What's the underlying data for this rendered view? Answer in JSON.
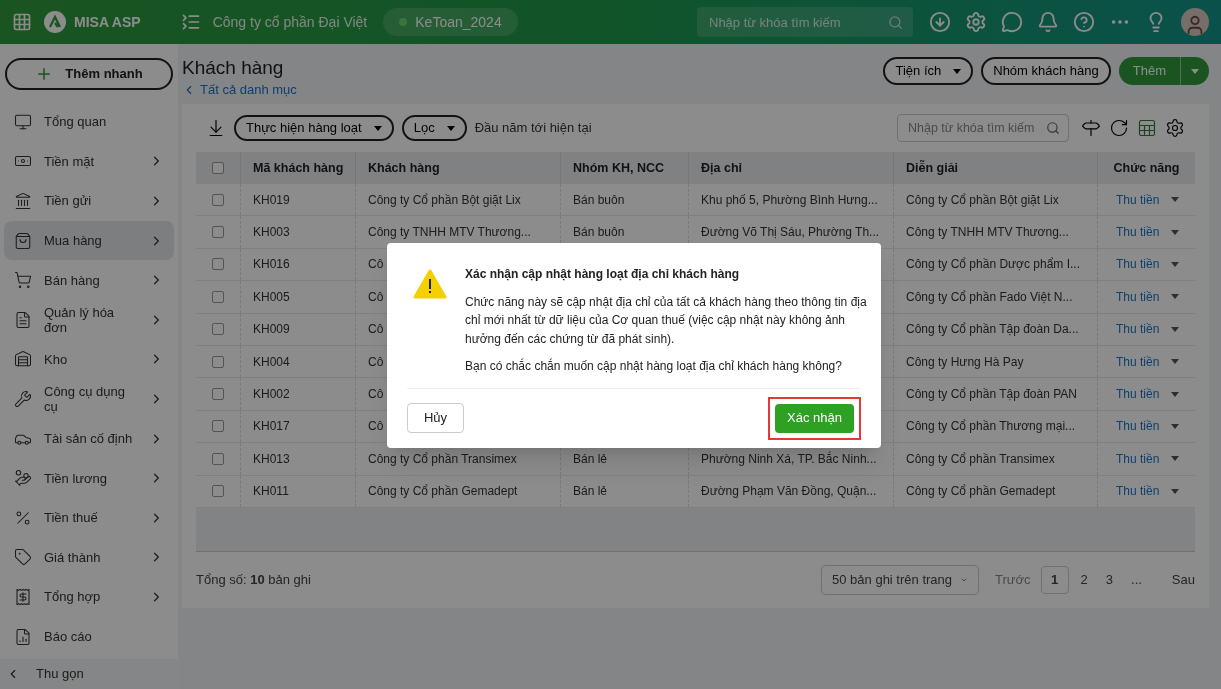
{
  "header": {
    "brand": "MISA ASP",
    "company": "Công ty cổ phần Đại Việt",
    "database": {
      "label": "KeToan_2024"
    },
    "search": {
      "placeholder": "Nhập từ khóa tìm kiếm"
    }
  },
  "sidebar": {
    "quick_add": "Thêm nhanh",
    "items": [
      {
        "label": "Tổng quan",
        "has_children": false,
        "selected": false
      },
      {
        "label": "Tiền mặt",
        "has_children": true,
        "selected": false
      },
      {
        "label": "Tiền gửi",
        "has_children": true,
        "selected": false
      },
      {
        "label": "Mua hàng",
        "has_children": true,
        "selected": true
      },
      {
        "label": "Bán hàng",
        "has_children": true,
        "selected": false
      },
      {
        "label": "Quản lý hóa đơn",
        "has_children": true,
        "selected": false
      },
      {
        "label": "Kho",
        "has_children": true,
        "selected": false
      },
      {
        "label": "Công cụ dụng cụ",
        "has_children": true,
        "selected": false
      },
      {
        "label": "Tài sản cố định",
        "has_children": true,
        "selected": false
      },
      {
        "label": "Tiền lương",
        "has_children": true,
        "selected": false
      },
      {
        "label": "Tiền thuế",
        "has_children": true,
        "selected": false
      },
      {
        "label": "Giá thành",
        "has_children": true,
        "selected": false
      },
      {
        "label": "Tổng hợp",
        "has_children": true,
        "selected": false
      },
      {
        "label": "Báo cáo",
        "has_children": false,
        "selected": false
      }
    ],
    "collapse": "Thu gọn"
  },
  "page": {
    "title": "Khách hàng",
    "back_link": "Tất cả danh mục",
    "actions": [
      "Tiện ích",
      "Nhóm khách hàng"
    ],
    "add_button": "Thêm"
  },
  "toolbar": {
    "batch": "Thực hiện hàng loạt",
    "filter": "Lọc",
    "period": "Đầu năm tới hiện tại",
    "search": {
      "placeholder": "Nhập từ khóa tìm kiếm"
    }
  },
  "table": {
    "all_checked": false,
    "columns": [
      "Mã khách hàng",
      "Khách hàng",
      "Nhóm KH, NCC",
      "Địa chỉ",
      "Diễn giải",
      "Chức năng"
    ],
    "rows": [
      {
        "checked": false,
        "code": "KH019",
        "customer": "Công ty Cổ phần Bột giặt Lix",
        "group": "Bán buôn",
        "address": "Khu phố 5, Phường Bình Hưng...",
        "description": "Công ty Cổ phần Bột giặt Lix",
        "action": "Thu tiền"
      },
      {
        "checked": false,
        "code": "KH003",
        "customer": "Công ty TNHH MTV Thương...",
        "group": "Bán buôn",
        "address": "Đường Võ Thị Sáu, Phường Th...",
        "description": "Công ty TNHH MTV Thương...",
        "action": "Thu tiền"
      },
      {
        "checked": false,
        "code": "KH016",
        "customer": "Cô",
        "description": "Công ty Cổ phần Dược phẩm I...",
        "action": "Thu tiền"
      },
      {
        "checked": false,
        "code": "KH005",
        "customer": "Cô",
        "description": "Công ty Cổ phần Fado Việt N...",
        "action": "Thu tiền"
      },
      {
        "checked": false,
        "code": "KH009",
        "customer": "Cô",
        "description": "Công ty Cổ phần Tập đoàn Da...",
        "action": "Thu tiền"
      },
      {
        "checked": false,
        "code": "KH004",
        "customer": "Cô",
        "description": "Công ty Hưng Hà Pay",
        "action": "Thu tiền"
      },
      {
        "checked": false,
        "code": "KH002",
        "customer": "Cô",
        "description": "Công ty Cổ phần Tập đoàn PAN",
        "action": "Thu tiền"
      },
      {
        "checked": false,
        "code": "KH017",
        "customer": "Cô",
        "description": "Công ty Cổ phần Thương mại...",
        "action": "Thu tiền"
      },
      {
        "checked": false,
        "code": "KH013",
        "customer": "Công ty Cổ phần Transimex",
        "group": "Bán lẻ",
        "address": "Phường Ninh Xá, TP. Bắc Ninh...",
        "description": "Công ty Cổ phần Transimex",
        "action": "Thu tiền"
      },
      {
        "checked": false,
        "code": "KH011",
        "customer": "Công ty Cổ phần Gemadept",
        "group": "Bán lẻ",
        "address": "Đường Phạm Văn Đồng, Quận...",
        "description": "Công ty Cổ phần Gemadept",
        "action": "Thu tiền"
      }
    ]
  },
  "footer": {
    "total": "Tổng số: **10** bản ghi",
    "page_size": "50 bản ghi trên trang",
    "prev": "Trước",
    "pages": [
      {
        "label": "1",
        "selected": true
      },
      {
        "label": "2",
        "selected": false
      },
      {
        "label": "3",
        "selected": false
      },
      {
        "label": "...",
        "selected": false
      }
    ],
    "next": "Sau"
  },
  "dialog": {
    "title": "Xác nhận cập nhật hàng loạt địa chỉ khách hàng",
    "message": "Chức năng này sẽ cập nhật địa chỉ của tất cả khách hàng theo thông tin địa chỉ mới nhất từ dữ liệu của Cơ quan thuế (việc cập nhật này không ảnh hưởng đến các chứng từ đã phát sinh).",
    "question": "Bạn có chắc chắn muốn cập nhật hàng loạt địa chỉ khách hàng không?",
    "cancel": "Hủy",
    "confirm": "Xác nhận",
    "confirm_highlighted": true
  }
}
